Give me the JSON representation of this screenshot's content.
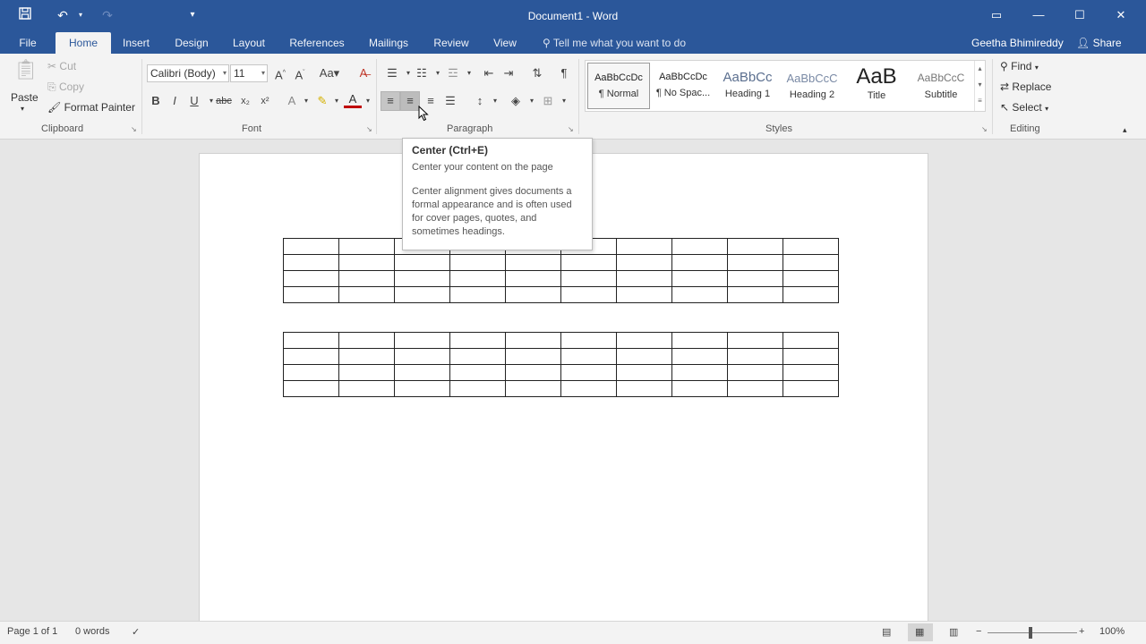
{
  "app": {
    "title": "Document1 - Word"
  },
  "quick_access": {
    "save_icon": "save-icon",
    "undo_icon": "undo-icon",
    "redo_icon": "redo-icon",
    "customize_icon": "customize-icon"
  },
  "tabs": [
    {
      "label": "File"
    },
    {
      "label": "Home"
    },
    {
      "label": "Insert"
    },
    {
      "label": "Design"
    },
    {
      "label": "Layout"
    },
    {
      "label": "References"
    },
    {
      "label": "Mailings"
    },
    {
      "label": "Review"
    },
    {
      "label": "View"
    }
  ],
  "active_tab": "Home",
  "tell_me": "Tell me what you want to do",
  "user_name": "Geetha Bhimireddy",
  "share_label": "Share",
  "clipboard": {
    "paste": "Paste",
    "cut": "Cut",
    "copy": "Copy",
    "format_painter": "Format Painter",
    "group": "Clipboard"
  },
  "font": {
    "name": "Calibri (Body)",
    "size": "11",
    "group": "Font"
  },
  "paragraph": {
    "group": "Paragraph"
  },
  "styles": {
    "group": "Styles",
    "items": [
      {
        "sample": "AaBbCcDc",
        "name": "¶ Normal"
      },
      {
        "sample": "AaBbCcDc",
        "name": "¶ No Spac..."
      },
      {
        "sample": "AaBbCc",
        "name": "Heading 1"
      },
      {
        "sample": "AaBbCcC",
        "name": "Heading 2"
      },
      {
        "sample": "AaB",
        "name": "Title"
      },
      {
        "sample": "AaBbCcC",
        "name": "Subtitle"
      }
    ]
  },
  "editing": {
    "find": "Find",
    "replace": "Replace",
    "select": "Select",
    "group": "Editing"
  },
  "tooltip": {
    "title": "Center (Ctrl+E)",
    "subtitle": "Center your content on the page",
    "body": "Center alignment gives documents a formal appearance and is often used for cover pages, quotes, and sometimes headings."
  },
  "status": {
    "page": "Page 1 of 1",
    "words": "0 words",
    "zoom": "100%"
  },
  "colors": {
    "brand": "#2b579a",
    "ribbon": "#f3f3f3",
    "canvas": "#e6e6e6"
  }
}
